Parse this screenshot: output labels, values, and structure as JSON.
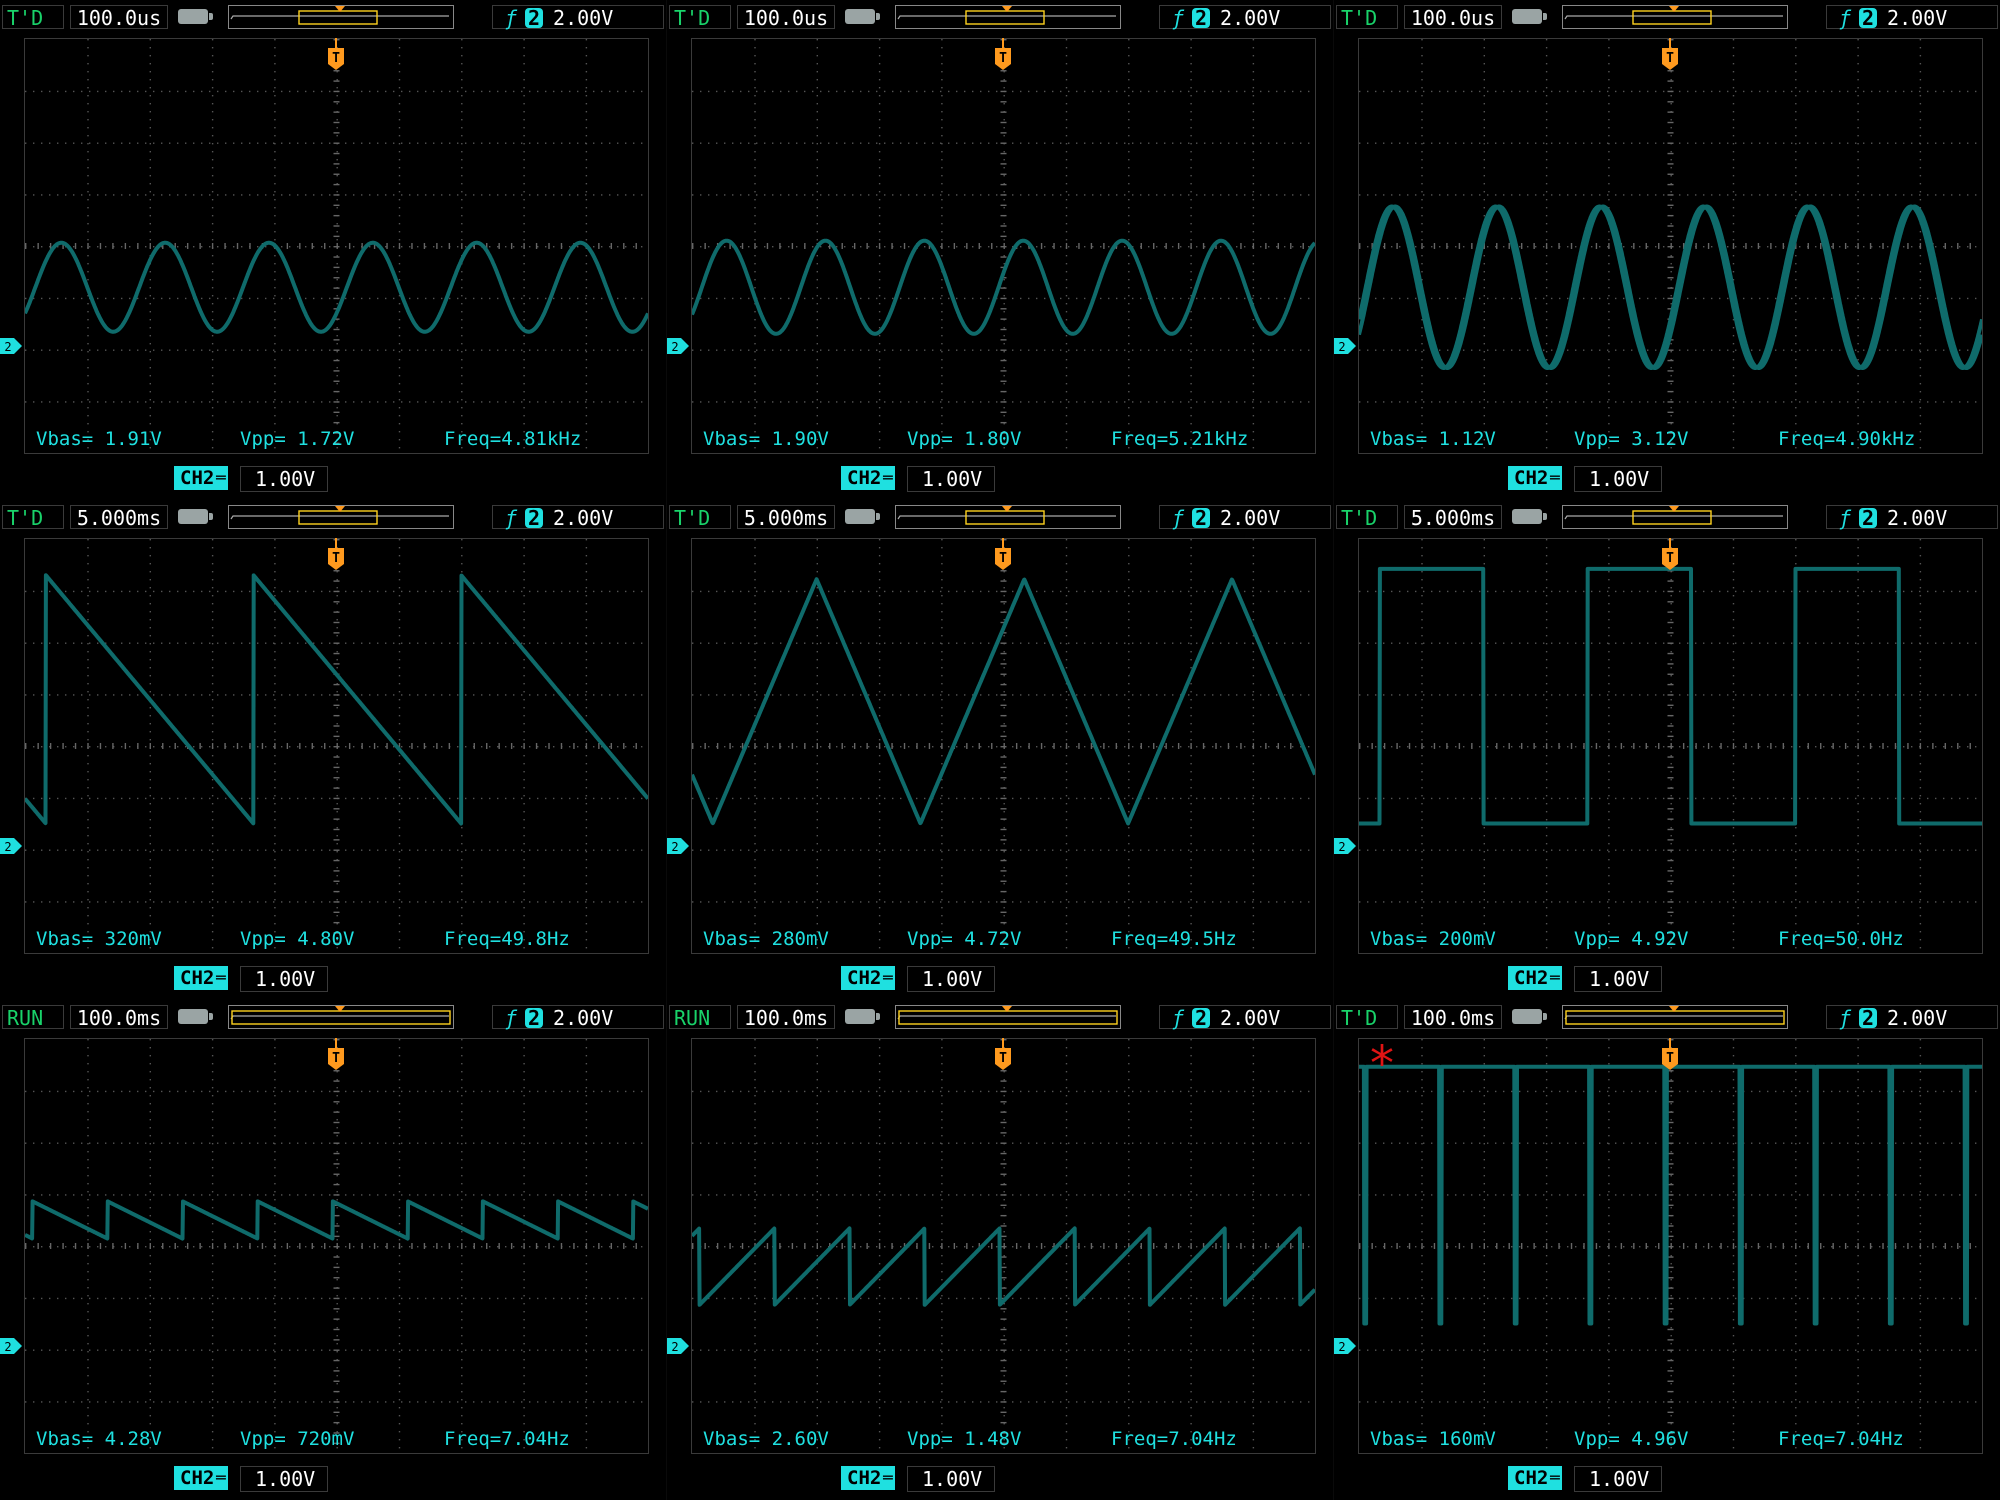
{
  "colors": {
    "trace": "#0f6b6b",
    "grid": "#2e2e2e",
    "accent": "#1fe0e0",
    "trigger": "#ff9a1e",
    "status": "#19d36a",
    "alert": "#e01414"
  },
  "icons": {
    "battery": "battery-icon",
    "trigger_edge": "rising-edge-icon",
    "trigger_position": "trigger-position-icon",
    "channel_ground": "channel-2-ground-icon"
  },
  "panels": [
    {
      "status": "T'D",
      "timebase": "100.0us",
      "trigger_channel": "2",
      "trigger_level": "2.00V",
      "vbas": "Vbas= 1.91V",
      "vpp": "Vpp= 1.72V",
      "freq": "Freq=4.81kHz",
      "channel": "CH2",
      "volts_div": "1.00V",
      "marker_channel": "2",
      "trig_marker": "T",
      "waveform": "sine",
      "cycles": 6,
      "amplitude_div": 0.86,
      "center_div": 1.0
    },
    {
      "status": "T'D",
      "timebase": "100.0us",
      "trigger_channel": "2",
      "trigger_level": "2.00V",
      "vbas": "Vbas= 1.90V",
      "vpp": "Vpp= 1.80V",
      "freq": "Freq=5.21kHz",
      "channel": "CH2",
      "volts_div": "1.00V",
      "marker_channel": "2",
      "trig_marker": "T",
      "waveform": "sine",
      "cycles": 6.3,
      "amplitude_div": 0.9,
      "center_div": 1.0
    },
    {
      "status": "T'D",
      "timebase": "100.0us",
      "trigger_channel": "2",
      "trigger_level": "2.00V",
      "vbas": "Vbas= 1.12V",
      "vpp": "Vpp= 3.12V",
      "freq": "Freq=4.90kHz",
      "channel": "CH2",
      "volts_div": "1.00V",
      "marker_channel": "2",
      "trig_marker": "T",
      "waveform": "sine-double",
      "cycles": 6,
      "amplitude_div": 1.56,
      "center_div": 1.0
    },
    {
      "status": "T'D",
      "timebase": "5.000ms",
      "trigger_channel": "2",
      "trigger_level": "2.00V",
      "vbas": "Vbas= 320mV",
      "vpp": "Vpp= 4.80V",
      "freq": "Freq=49.8Hz",
      "channel": "CH2",
      "volts_div": "1.00V",
      "marker_channel": "2",
      "trig_marker": "T",
      "waveform": "sawtooth-down",
      "cycles": 3,
      "amplitude_div": 2.4,
      "center_div": 0.0
    },
    {
      "status": "T'D",
      "timebase": "5.000ms",
      "trigger_channel": "2",
      "trigger_level": "2.00V",
      "vbas": "Vbas= 280mV",
      "vpp": "Vpp= 4.72V",
      "freq": "Freq=49.5Hz",
      "channel": "CH2",
      "volts_div": "1.00V",
      "marker_channel": "2",
      "trig_marker": "T",
      "waveform": "triangle",
      "cycles": 3,
      "amplitude_div": 2.36,
      "center_div": 0.0
    },
    {
      "status": "T'D",
      "timebase": "5.000ms",
      "trigger_channel": "2",
      "trigger_level": "2.00V",
      "vbas": "Vbas= 200mV",
      "vpp": "Vpp= 4.92V",
      "freq": "Freq=50.0Hz",
      "channel": "CH2",
      "volts_div": "1.00V",
      "marker_channel": "2",
      "trig_marker": "T",
      "waveform": "square",
      "cycles": 3,
      "amplitude_div": 2.46,
      "center_div": 0.0
    },
    {
      "status": "RUN",
      "timebase": "100.0ms",
      "trigger_channel": "2",
      "trigger_level": "2.00V",
      "vbas": "Vbas= 4.28V",
      "vpp": "Vpp= 720mV",
      "freq": "Freq=7.04Hz",
      "channel": "CH2",
      "volts_div": "1.00V",
      "marker_channel": "2",
      "trig_marker": "T",
      "waveform": "sawtooth-down",
      "cycles": 8.3,
      "amplitude_div": 0.36,
      "center_div": 2.3
    },
    {
      "status": "RUN",
      "timebase": "100.0ms",
      "trigger_channel": "2",
      "trigger_level": "2.00V",
      "vbas": "Vbas= 2.60V",
      "vpp": "Vpp= 1.48V",
      "freq": "Freq=7.04Hz",
      "channel": "CH2",
      "volts_div": "1.00V",
      "marker_channel": "2",
      "trig_marker": "T",
      "waveform": "sawtooth-up",
      "cycles": 8.3,
      "amplitude_div": 0.74,
      "center_div": 1.4
    },
    {
      "status": "T'D",
      "timebase": "100.0ms",
      "trigger_channel": "2",
      "trigger_level": "2.00V",
      "vbas": "Vbas= 160mV",
      "vpp": "Vpp= 4.96V",
      "freq": "Freq=7.04Hz",
      "channel": "CH2",
      "volts_div": "1.00V",
      "marker_channel": "2",
      "trig_marker": "T",
      "waveform": "pulse-down",
      "cycles": 8.3,
      "amplitude_div": 2.48,
      "center_div": 0.0,
      "annotation": "*"
    }
  ]
}
